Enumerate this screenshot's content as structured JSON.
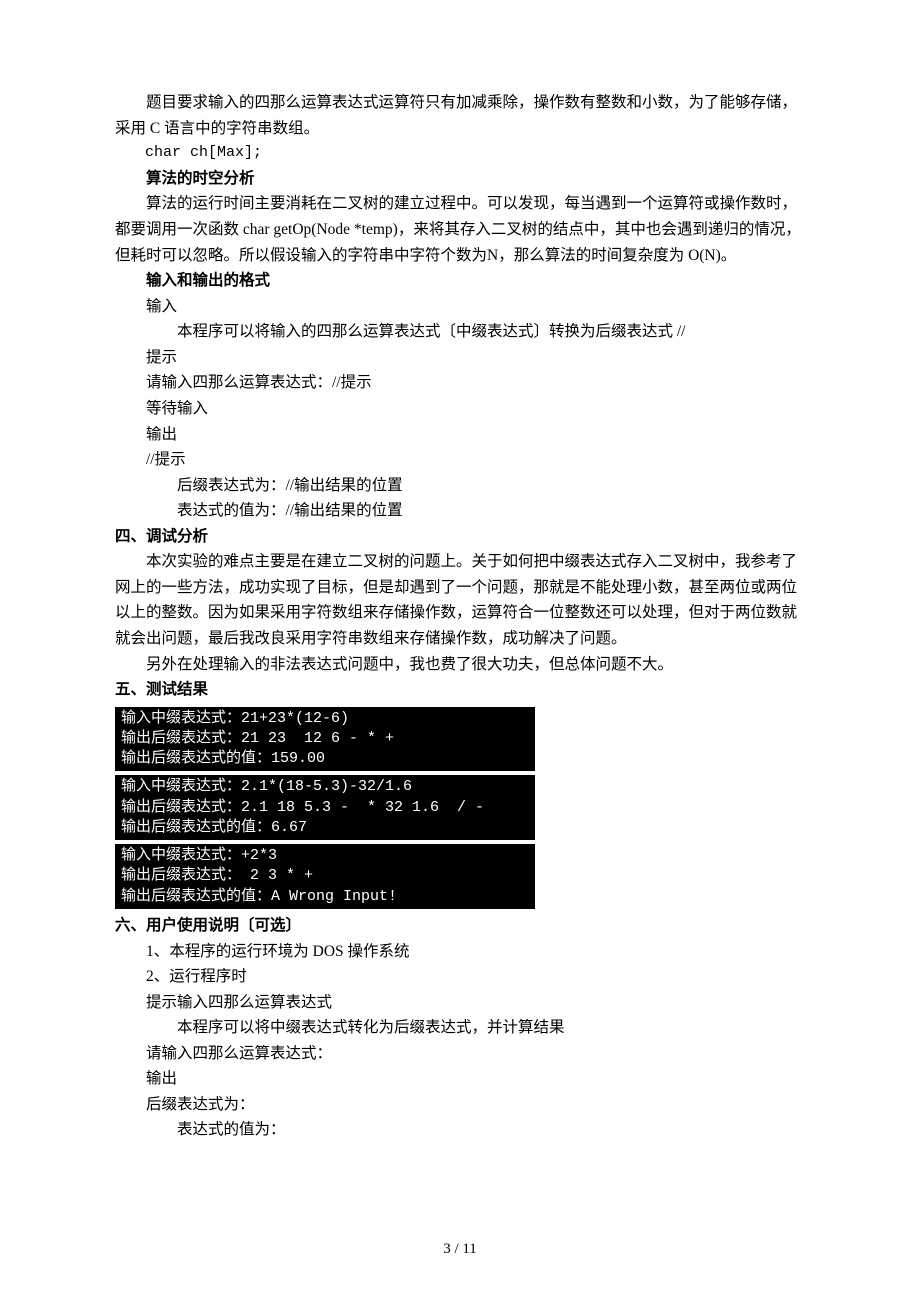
{
  "body": {
    "p1": "题目要求输入的四那么运算表达式运算符只有加减乘除，操作数有整数和小数，为了能够存储，采用 C 语言中的字符串数组。",
    "code1": "char ch[Max];",
    "h1": "算法的时空分析",
    "p2": "算法的运行时间主要消耗在二叉树的建立过程中。可以发现，每当遇到一个运算符或操作数时，都要调用一次函数 char getOp(Node *temp)，来将其存入二叉树的结点中，其中也会遇到递归的情况，但耗时可以忽略。所以假设输入的字符串中字符个数为N，那么算法的时间复杂度为 O(N)。",
    "h2": "输入和输出的格式",
    "io1": "输入",
    "io2": "本程序可以将输入的四那么运算表达式〔中缀表达式〕转换为后缀表达式    //",
    "io3": "提示",
    "io4": "请输入四那么运算表达式：//提示",
    "io5": "等待输入",
    "io6": "输出",
    "io7": "//提示",
    "io8": "后缀表达式为：//输出结果的位置",
    "io9": "表达式的值为：//输出结果的位置"
  },
  "sec4": {
    "title": "四、调试分析",
    "p1": "本次实验的难点主要是在建立二叉树的问题上。关于如何把中缀表达式存入二叉树中，我参考了网上的一些方法，成功实现了目标，但是却遇到了一个问题，那就是不能处理小数，甚至两位或两位以上的整数。因为如果采用字符数组来存储操作数，运算符合一位整数还可以处理，但对于两位数就就会出问题，最后我改良采用字符串数组来存储操作数，成功解决了问题。",
    "p2": "另外在处理输入的非法表达式问题中，我也费了很大功夫，但总体问题不大。"
  },
  "sec5": {
    "title": "五、测试结果",
    "c1l1": "输入中缀表达式：21+23*(12-6)",
    "c1l2": "输出后缀表达式：21 23  12 6 - * +",
    "c1l3": "输出后缀表达式的值：159.00",
    "c2l1": "输入中缀表达式：2.1*(18-5.3)-32/1.6",
    "c2l2": "输出后缀表达式：2.1 18 5.3 -  * 32 1.6  / -",
    "c2l3": "输出后缀表达式的值：6.67",
    "c3l1": "输入中缀表达式：+2*3",
    "c3l2": "输出后缀表达式： 2 3 * +",
    "c3l3": "输出后缀表达式的值：A Wrong Input!"
  },
  "sec6": {
    "title": "六、用户使用说明〔可选〕",
    "l1": "1、本程序的运行环境为 DOS 操作系统",
    "l2": "2、运行程序时",
    "l3": "提示输入四那么运算表达式",
    "l4": "本程序可以将中缀表达式转化为后缀表达式，并计算结果",
    "l5": "请输入四那么运算表达式：",
    "l6": "输出",
    "l7": "后缀表达式为：",
    "l8": "表达式的值为："
  },
  "footer": "3 / 11"
}
